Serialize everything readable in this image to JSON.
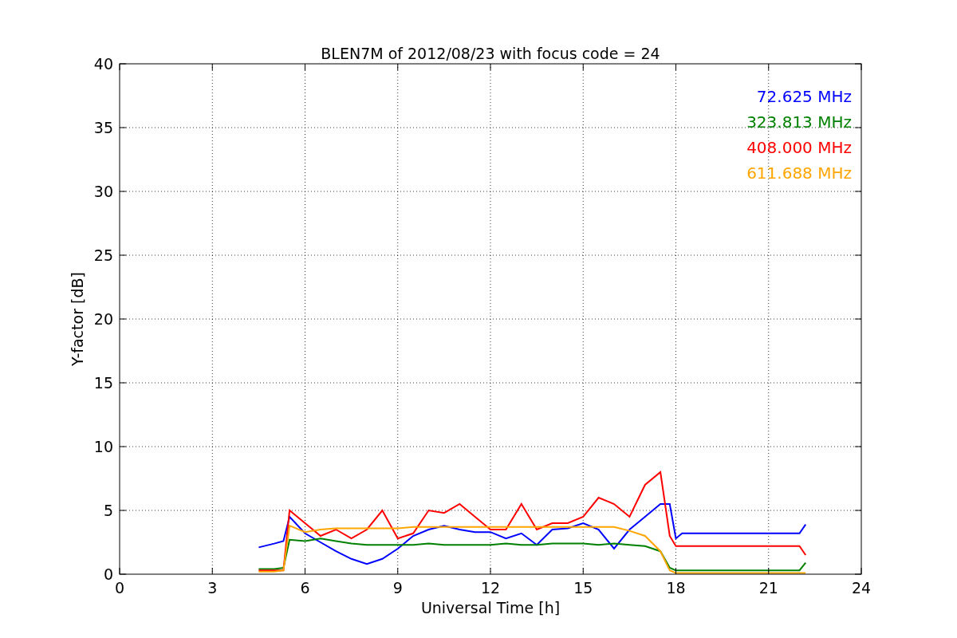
{
  "chart_data": {
    "type": "line",
    "title": "BLEN7M of 2012/08/23 with focus code = 24",
    "xlabel": "Universal Time [h]",
    "ylabel": "Y-factor [dB]",
    "x": [
      4.5,
      5,
      5.3,
      5.5,
      6,
      6.5,
      7,
      7.5,
      8,
      8.5,
      9,
      9.5,
      10,
      10.5,
      11,
      11.5,
      12,
      12.5,
      13,
      13.5,
      14,
      14.5,
      15,
      15.5,
      16,
      16.5,
      17,
      17.5,
      17.8,
      18,
      18.2,
      22,
      22.2
    ],
    "series": [
      {
        "name": "72.625 MHz",
        "color": "#0000ff",
        "values": [
          2.1,
          2.4,
          2.6,
          4.5,
          3.2,
          2.5,
          1.8,
          1.2,
          0.8,
          1.2,
          2,
          3,
          3.5,
          3.8,
          3.5,
          3.3,
          3.3,
          2.8,
          3.2,
          2.3,
          3.5,
          3.6,
          4,
          3.5,
          2,
          3.5,
          4.5,
          5.5,
          5.5,
          2.8,
          3.2,
          3.2,
          3.9
        ]
      },
      {
        "name": "323.813 MHz",
        "color": "#008000",
        "values": [
          0.4,
          0.4,
          0.5,
          2.7,
          2.6,
          2.8,
          2.6,
          2.4,
          2.3,
          2.3,
          2.3,
          2.3,
          2.4,
          2.3,
          2.3,
          2.3,
          2.3,
          2.4,
          2.3,
          2.3,
          2.4,
          2.4,
          2.4,
          2.3,
          2.4,
          2.3,
          2.2,
          1.8,
          0.5,
          0.3,
          0.3,
          0.3,
          0.9
        ]
      },
      {
        "name": "408.000 MHz",
        "color": "#ff0000",
        "values": [
          0.3,
          0.3,
          0.3,
          5,
          4,
          3,
          3.5,
          2.8,
          3.5,
          5,
          2.8,
          3.2,
          5,
          4.8,
          5.5,
          4.5,
          3.5,
          3.5,
          5.5,
          3.5,
          4,
          4,
          4.5,
          6,
          5.5,
          4.5,
          7,
          8,
          3,
          2.2,
          2.2,
          2.2,
          1.5
        ]
      },
      {
        "name": "611.688 MHz",
        "color": "#ffa500",
        "values": [
          0.2,
          0.2,
          0.3,
          3.8,
          3.3,
          3.5,
          3.6,
          3.6,
          3.6,
          3.6,
          3.6,
          3.7,
          3.7,
          3.7,
          3.7,
          3.7,
          3.7,
          3.7,
          3.7,
          3.7,
          3.7,
          3.7,
          3.7,
          3.7,
          3.7,
          3.4,
          3,
          1.8,
          0.3,
          0.1,
          0.1,
          0.1,
          0.1
        ]
      }
    ],
    "grid": true,
    "xlim": [
      0,
      24
    ],
    "ylim": [
      0,
      40
    ],
    "xticks": [
      0,
      3,
      6,
      9,
      12,
      15,
      18,
      21,
      24
    ],
    "yticks": [
      0,
      5,
      10,
      15,
      20,
      25,
      30,
      35,
      40
    ]
  }
}
